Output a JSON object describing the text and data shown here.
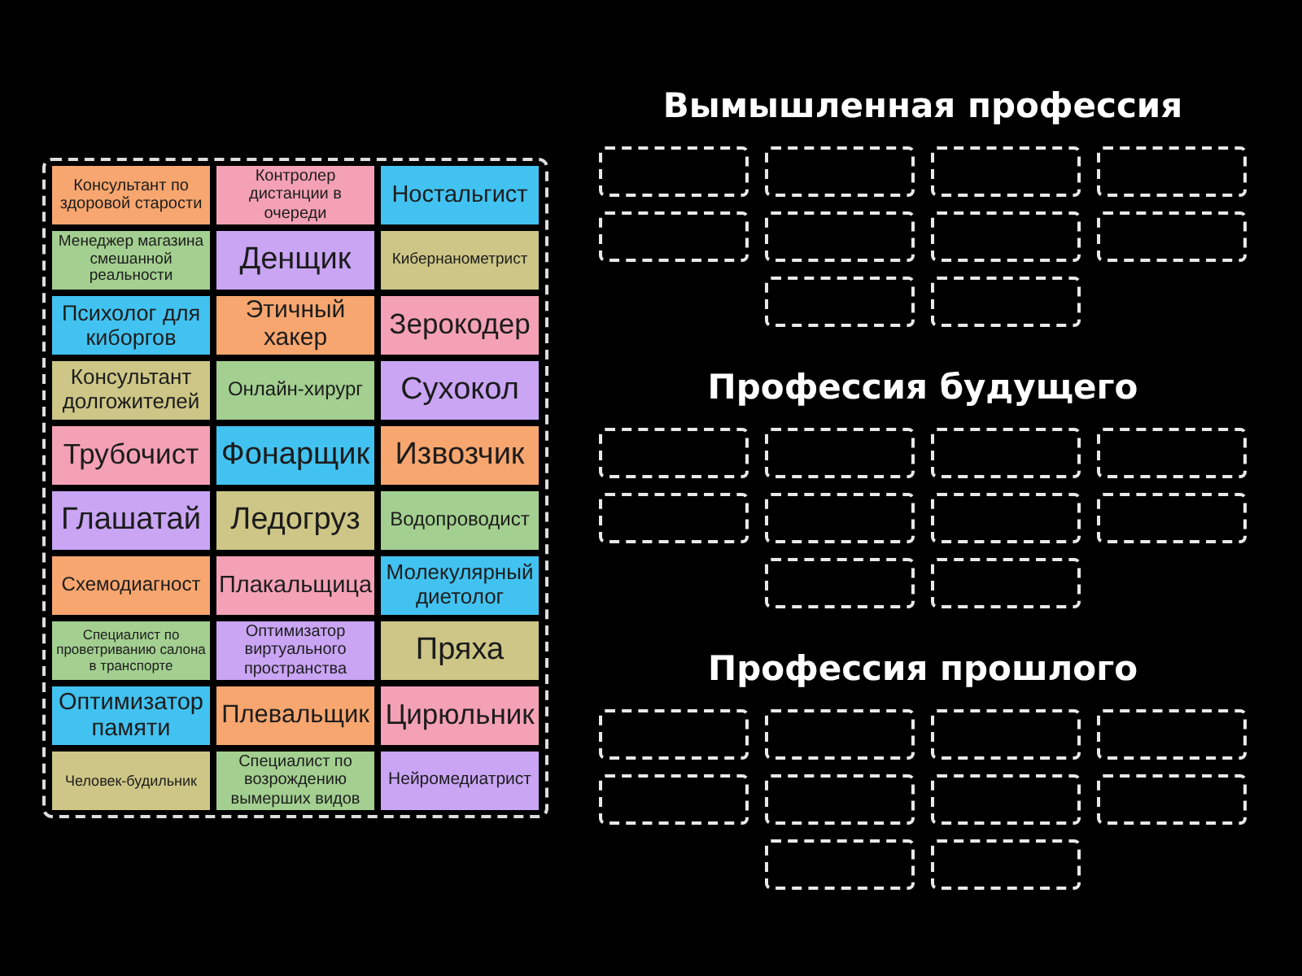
{
  "tiles": [
    {
      "text": "Консультант по здоровой старости",
      "color": "#f7a66f"
    },
    {
      "text": "Контролер дистанции в очереди",
      "color": "#f4a1b5"
    },
    {
      "text": "Ностальгист",
      "color": "#42c2f0"
    },
    {
      "text": "Менеджер магазина смешанной реальности",
      "color": "#a3cf90"
    },
    {
      "text": "Денщик",
      "color": "#c9a5f4"
    },
    {
      "text": "Кибернанометрист",
      "color": "#cdc686"
    },
    {
      "text": "Психолог для киборгов",
      "color": "#42c2f0"
    },
    {
      "text": "Этичный хакер",
      "color": "#f7a66f"
    },
    {
      "text": "Зерокодер",
      "color": "#f4a1b5"
    },
    {
      "text": "Консультант долгожителей",
      "color": "#cdc686"
    },
    {
      "text": "Онлайн-хирург",
      "color": "#a3cf90"
    },
    {
      "text": "Сухокол",
      "color": "#c9a5f4"
    },
    {
      "text": "Трубочист",
      "color": "#f4a1b5"
    },
    {
      "text": "Фонарщик",
      "color": "#42c2f0"
    },
    {
      "text": "Извозчик",
      "color": "#f7a66f"
    },
    {
      "text": "Глашатай",
      "color": "#c9a5f4"
    },
    {
      "text": "Ледогруз",
      "color": "#cdc686"
    },
    {
      "text": "Водопроводист",
      "color": "#a3cf90"
    },
    {
      "text": "Схемодиагност",
      "color": "#f7a66f"
    },
    {
      "text": "Плакальщица",
      "color": "#f4a1b5"
    },
    {
      "text": "Молекулярный диетолог",
      "color": "#42c2f0"
    },
    {
      "text": "Специалист по проветриванию салона в транспорте",
      "color": "#a3cf90"
    },
    {
      "text": "Оптимизатор виртуального пространства",
      "color": "#c9a5f4"
    },
    {
      "text": "Пряха",
      "color": "#cdc686"
    },
    {
      "text": "Оптимизатор памяти",
      "color": "#42c2f0"
    },
    {
      "text": "Плевальщик",
      "color": "#f7a66f"
    },
    {
      "text": "Цирюльник",
      "color": "#f4a1b5"
    },
    {
      "text": "Человек-будильник",
      "color": "#cdc686"
    },
    {
      "text": "Специалист по возрождению вымерших видов",
      "color": "#a3cf90"
    },
    {
      "text": "Нейромедиатрист",
      "color": "#c9a5f4"
    }
  ],
  "groups": [
    {
      "title": "Вымышленная профессия",
      "slots": [
        {
          "empty": true
        },
        {
          "empty": true
        },
        {
          "empty": true
        },
        {
          "empty": true
        },
        {
          "empty": true
        },
        {
          "empty": true
        },
        {
          "empty": true
        },
        {
          "empty": true
        },
        {
          "empty": true
        },
        {
          "empty": true
        }
      ]
    },
    {
      "title": "Профессия будущего",
      "slots": [
        {
          "empty": true
        },
        {
          "empty": true
        },
        {
          "empty": true
        },
        {
          "empty": true
        },
        {
          "empty": true
        },
        {
          "empty": true
        },
        {
          "empty": true
        },
        {
          "empty": true
        },
        {
          "empty": true
        },
        {
          "empty": true
        }
      ]
    },
    {
      "title": "Профессия прошлого",
      "slots": [
        {
          "empty": true
        },
        {
          "empty": true
        },
        {
          "empty": true
        },
        {
          "empty": true
        },
        {
          "empty": true
        },
        {
          "empty": true
        },
        {
          "empty": true
        },
        {
          "empty": true
        },
        {
          "empty": true
        },
        {
          "empty": true
        }
      ]
    }
  ]
}
